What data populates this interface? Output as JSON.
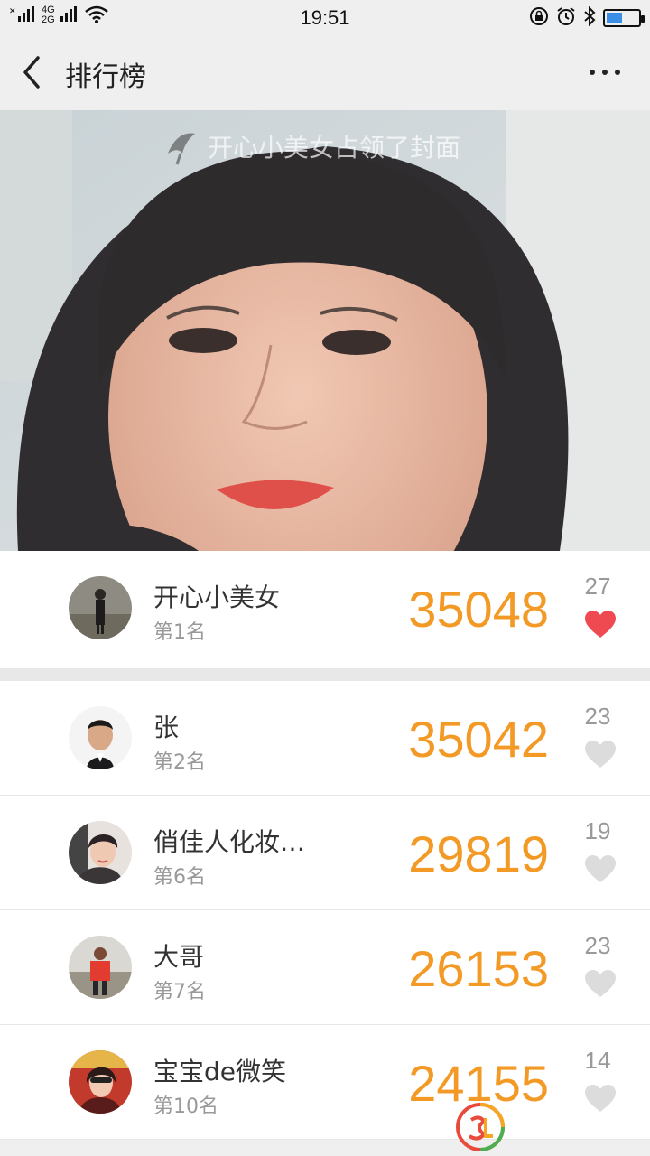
{
  "status": {
    "signal_left": "4G",
    "signal_sub": "2G",
    "time": "19:51"
  },
  "nav": {
    "title": "排行榜",
    "more_label": "•••"
  },
  "cover": {
    "caption": "开心小美女占领了封面"
  },
  "entries": [
    {
      "name": "开心小美女",
      "rank": "第1名",
      "score": "35048",
      "likes": "27",
      "liked": true
    },
    {
      "name": "张",
      "rank": "第2名",
      "score": "35042",
      "likes": "23",
      "liked": false
    },
    {
      "name": "俏佳人化妆…",
      "rank": "第6名",
      "score": "29819",
      "likes": "19",
      "liked": false
    },
    {
      "name": "大哥",
      "rank": "第7名",
      "score": "26153",
      "likes": "23",
      "liked": false
    },
    {
      "name": "宝宝de微笑",
      "rank": "第10名",
      "score": "24155",
      "likes": "14",
      "liked": false
    }
  ],
  "colors": {
    "score": "#f39a26",
    "heart_active": "#ef4a52",
    "heart_inactive": "#dcdcdc"
  }
}
